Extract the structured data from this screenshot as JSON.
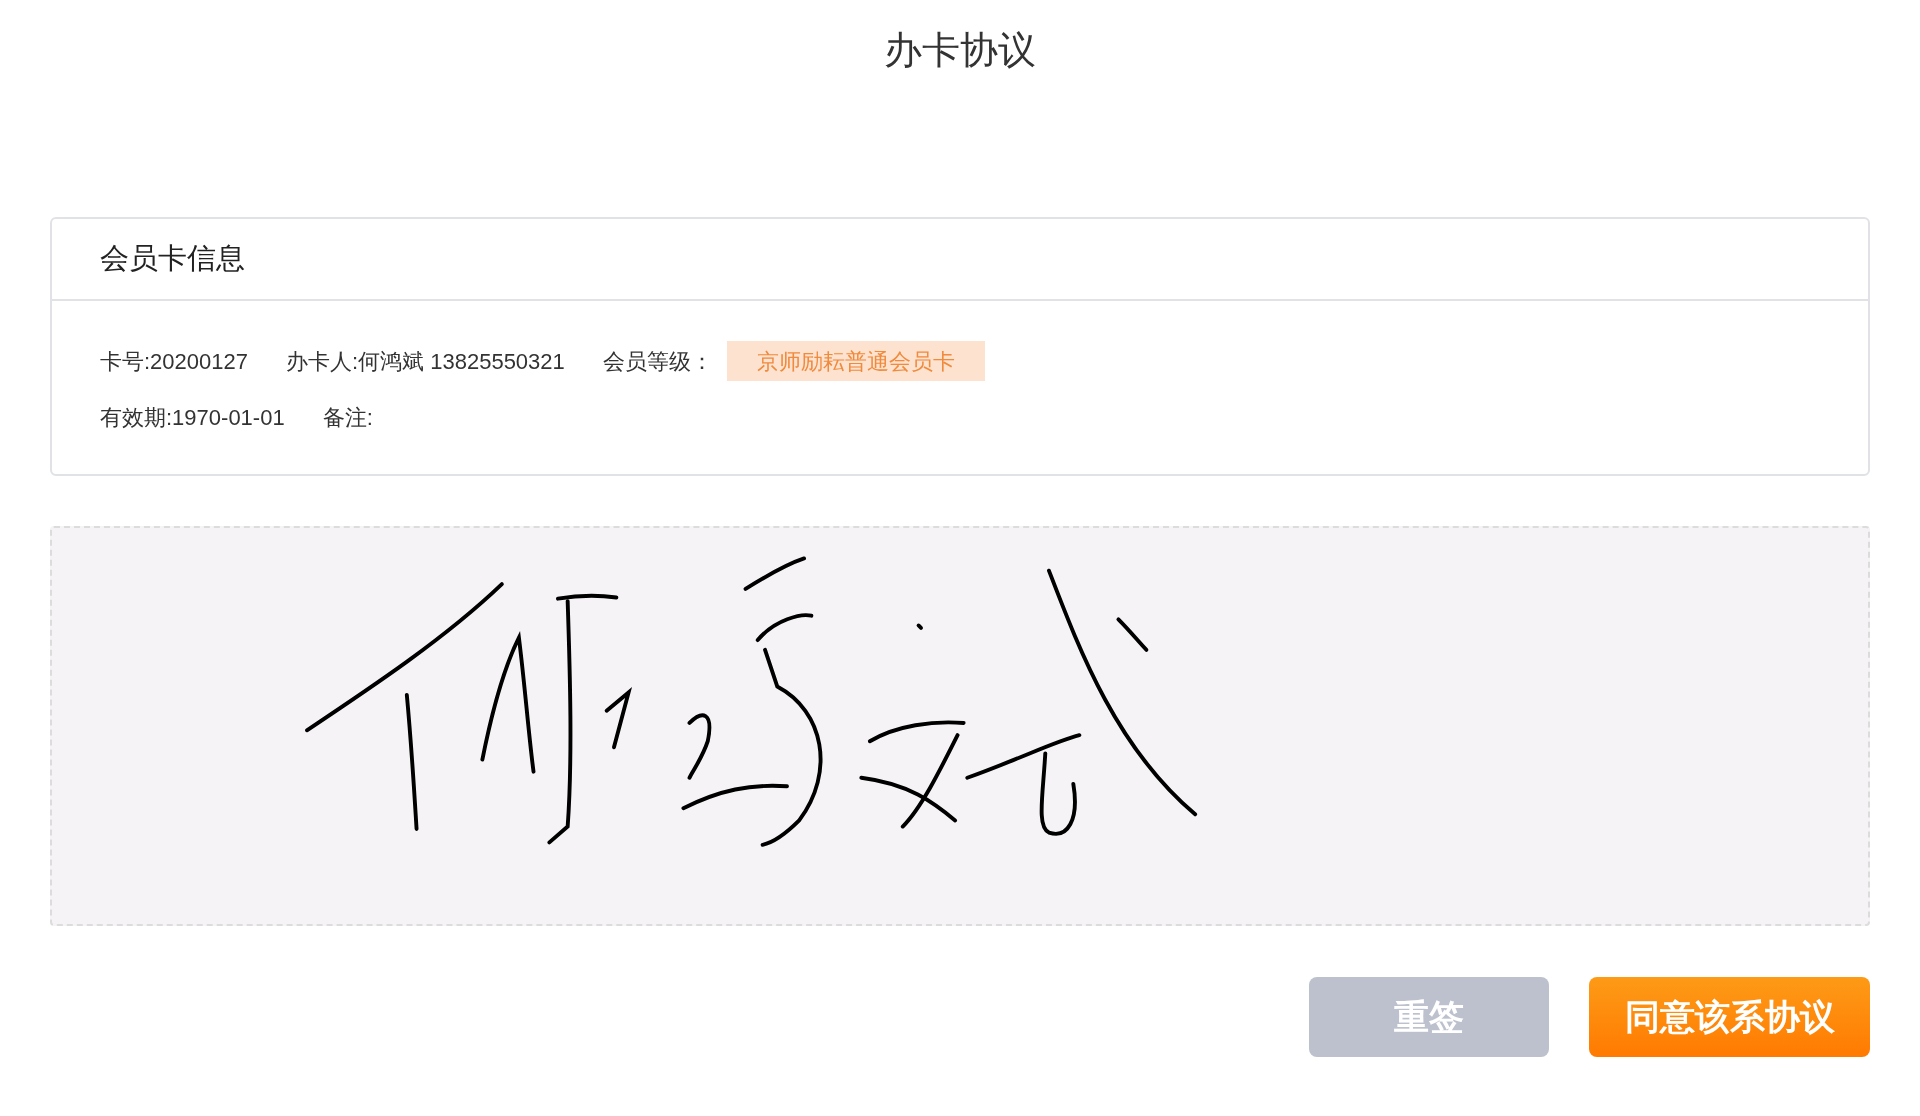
{
  "page": {
    "title": "办卡协议"
  },
  "card": {
    "title": "会员卡信息",
    "rows": [
      [
        {
          "kind": "text",
          "text": "卡号:20200127"
        },
        {
          "kind": "text",
          "text": "办卡人:何鸿斌 13825550321"
        },
        {
          "kind": "text",
          "text": "会员等级："
        },
        {
          "kind": "badge",
          "text": "京师励耘普通会员卡"
        }
      ],
      [
        {
          "kind": "text",
          "text": "有效期:1970-01-01"
        },
        {
          "kind": "text",
          "text": "备注:"
        }
      ]
    ]
  },
  "signature_pad": {
    "signed": true
  },
  "buttons": [
    {
      "label": "重签",
      "kind": "secondary"
    },
    {
      "label": "同意该系协议",
      "kind": "primary"
    }
  ]
}
